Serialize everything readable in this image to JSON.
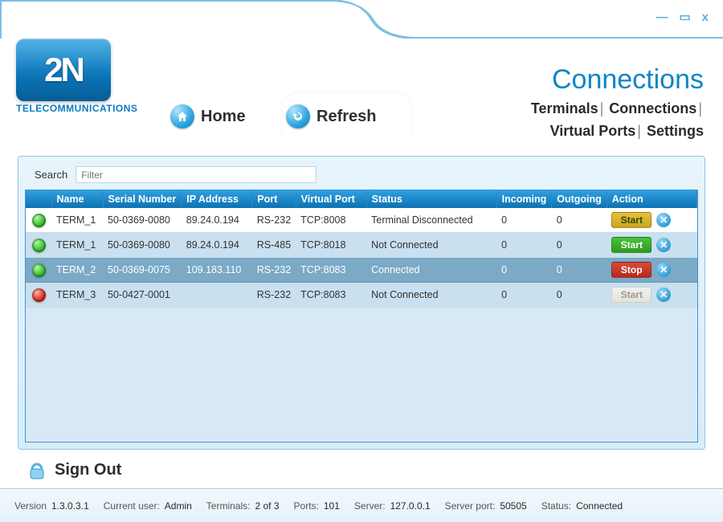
{
  "window": {
    "minimize_glyph": "—",
    "restore_glyph": "▭",
    "close_glyph": "x"
  },
  "brand": {
    "logo_text": "2N",
    "logo_sub": "TELECOMMUNICATIONS"
  },
  "nav": {
    "home_label": "Home",
    "refresh_label": "Refresh"
  },
  "page": {
    "title": "Connections",
    "links": {
      "terminals": "Terminals",
      "connections": "Connections",
      "virtual_ports": "Virtual Ports",
      "settings": "Settings"
    }
  },
  "search": {
    "label": "Search",
    "placeholder": "Filter",
    "value": ""
  },
  "table": {
    "headers": {
      "name": "Name",
      "serial": "Serial Number",
      "ip": "IP Address",
      "port": "Port",
      "vport": "Virtual Port",
      "status": "Status",
      "incoming": "Incoming",
      "outgoing": "Outgoing",
      "action": "Action"
    },
    "rows": [
      {
        "dot": "green",
        "name": "TERM_1",
        "serial": "50-0369-0080",
        "ip": "89.24.0.194",
        "port": "RS-232",
        "vport": "TCP:8008",
        "status": "Terminal Disconnected",
        "incoming": "0",
        "outgoing": "0",
        "action_label": "Start",
        "action_style": "yellow",
        "selected": false,
        "alt": false
      },
      {
        "dot": "green",
        "name": "TERM_1",
        "serial": "50-0369-0080",
        "ip": "89.24.0.194",
        "port": "RS-485",
        "vport": "TCP:8018",
        "status": "Not Connected",
        "incoming": "0",
        "outgoing": "0",
        "action_label": "Start",
        "action_style": "green",
        "selected": false,
        "alt": true
      },
      {
        "dot": "green",
        "name": "TERM_2",
        "serial": "50-0369-0075",
        "ip": "109.183.110",
        "port": "RS-232",
        "vport": "TCP:8083",
        "status": "Connected",
        "incoming": "0",
        "outgoing": "0",
        "action_label": "Stop",
        "action_style": "red",
        "selected": true,
        "alt": false
      },
      {
        "dot": "red",
        "name": "TERM_3",
        "serial": "50-0427-0001",
        "ip": "",
        "port": "RS-232",
        "vport": "TCP:8083",
        "status": "Not Connected",
        "incoming": "0",
        "outgoing": "0",
        "action_label": "Start",
        "action_style": "gray",
        "selected": false,
        "alt": true
      }
    ]
  },
  "signout": {
    "label": "Sign Out"
  },
  "statusbar": {
    "version_k": "Version",
    "version_v": "1.3.0.3.1",
    "user_k": "Current user:",
    "user_v": "Admin",
    "terms_k": "Terminals:",
    "terms_v": "2  of  3",
    "ports_k": "Ports:",
    "ports_v": "101",
    "server_k": "Server:",
    "server_v": "127.0.0.1",
    "sport_k": "Server port:",
    "sport_v": "50505",
    "status_k": "Status:",
    "status_v": "Connected"
  }
}
